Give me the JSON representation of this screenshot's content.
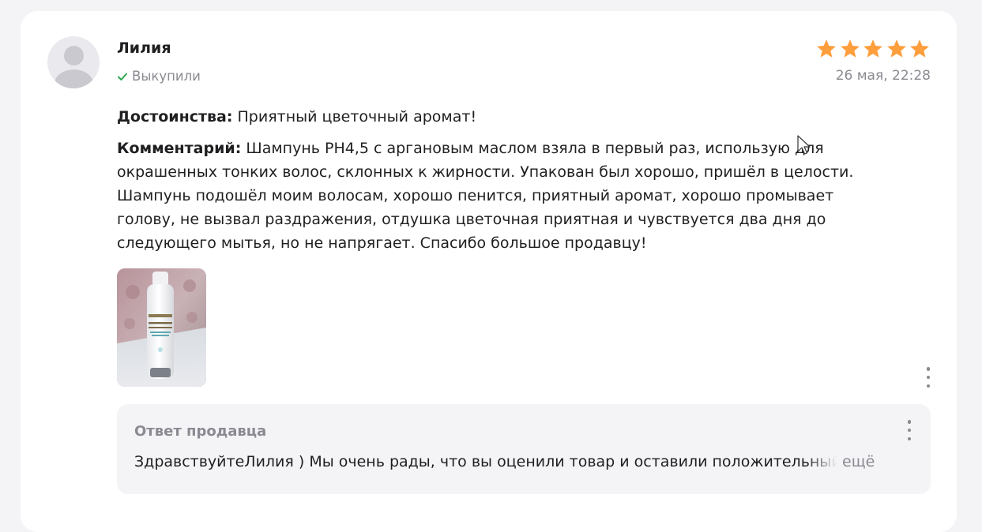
{
  "review": {
    "author": "Лилия",
    "bought_label": "Выкупили",
    "rating": 5,
    "rating_max": 5,
    "date": "26 мая, 22:28",
    "pros_label": "Достоинства:",
    "pros_text": "Приятный цветочный аромат!",
    "comment_label": "Комментарий:",
    "comment_text": "Шампунь PH4,5 с аргановым маслом взяла в первый раз, использую для окрашенных тонких волос, склонных к жирности. Упакован был хорошо, пришёл в целости. Шампунь подошёл моим волосам, хорошо пенится, приятный аромат, хорошо промывает голову, не вызвал раздражения, отдушка цветочная приятная и чувствуется два дня до следующего мытья, но не напрягает. Спасибо большое продавцу!",
    "photo": {
      "description_icon": "product-photo-shampoo-bottle"
    }
  },
  "seller_reply": {
    "title": "Ответ продавца",
    "text": "ЗдравствуйтеЛилия ) Мы очень рады, что вы оценили товар и оставили положительный",
    "more_label": "ещё"
  },
  "icons": {
    "star": "star-icon",
    "check": "check-icon",
    "menu": "more-vertical-icon",
    "avatar": "user-avatar-icon"
  },
  "colors": {
    "star": "#ff9e3d",
    "check": "#2fa84f",
    "muted_text": "#8a8a92",
    "card_bg": "#ffffff",
    "page_bg": "#f4f4f6",
    "reply_bg": "#f4f4f6"
  }
}
